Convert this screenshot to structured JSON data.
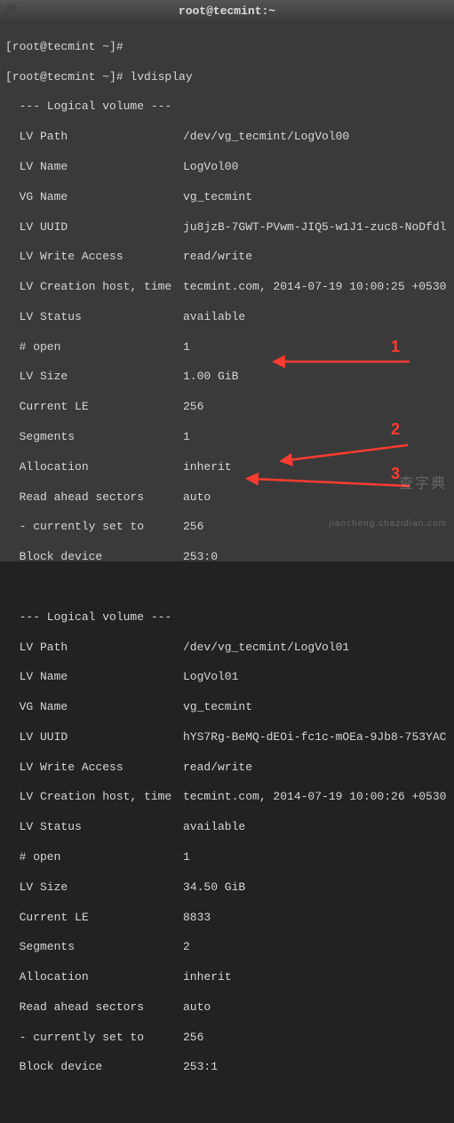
{
  "window": {
    "title": "root@tecmint:~"
  },
  "prompts": {
    "p1": "[root@tecmint ~]#",
    "p2": "[root@tecmint ~]# lvdisplay"
  },
  "sections": {
    "header": "  --- Logical volume ---"
  },
  "lv1": {
    "path_k": "  LV Path",
    "path_v": "/dev/vg_tecmint/LogVol00",
    "name_k": "  LV Name",
    "name_v": "LogVol00",
    "vg_k": "  VG Name",
    "vg_v": "vg_tecmint",
    "uuid_k": "  LV UUID",
    "uuid_v": "ju8jzB-7GWT-PVwm-JIQ5-w1J1-zuc8-NoDfdl",
    "wa_k": "  LV Write Access",
    "wa_v": "read/write",
    "ch_k": "  LV Creation host, time",
    "ch_v": "tecmint.com, 2014-07-19 10:00:25 +0530",
    "st_k": "  LV Status",
    "st_v": "available",
    "op_k": "  # open",
    "op_v": "1",
    "sz_k": "  LV Size",
    "sz_v": "1.00 GiB",
    "le_k": "  Current LE",
    "le_v": "256",
    "sg_k": "  Segments",
    "sg_v": "1",
    "al_k": "  Allocation",
    "al_v": "inherit",
    "ra_k": "  Read ahead sectors",
    "ra_v": "auto",
    "cs_k": "  - currently set to",
    "cs_v": "256",
    "bd_k": "  Block device",
    "bd_v": "253:0"
  },
  "lv2": {
    "path_k": "  LV Path",
    "path_v": "/dev/vg_tecmint/LogVol01",
    "name_k": "  LV Name",
    "name_v": "LogVol01",
    "vg_k": "  VG Name",
    "vg_v": "vg_tecmint",
    "uuid_k": "  LV UUID",
    "uuid_v": "hYS7Rg-BeMQ-dEOi-fc1c-mOEa-9Jb8-753YAC",
    "wa_k": "  LV Write Access",
    "wa_v": "read/write",
    "ch_k": "  LV Creation host, time",
    "ch_v": "tecmint.com, 2014-07-19 10:00:26 +0530",
    "st_k": "  LV Status",
    "st_v": "available",
    "op_k": "  # open",
    "op_v": "1",
    "sz_k": "  LV Size",
    "sz_v": "34.50 GiB",
    "le_k": "  Current LE",
    "le_v": "8833",
    "sg_k": "  Segments",
    "sg_v": "2",
    "al_k": "  Allocation",
    "al_v": "inherit",
    "ra_k": "  Read ahead sectors",
    "ra_v": "auto",
    "cs_k": "  - currently set to",
    "cs_v": "256",
    "bd_k": "  Block device",
    "bd_v": "253:1"
  },
  "annotations": {
    "a1": "1",
    "a2": "2",
    "a3": "3"
  },
  "watermark": {
    "line1": "查字典",
    "line2": "jiaocheng.chazidian.com"
  }
}
